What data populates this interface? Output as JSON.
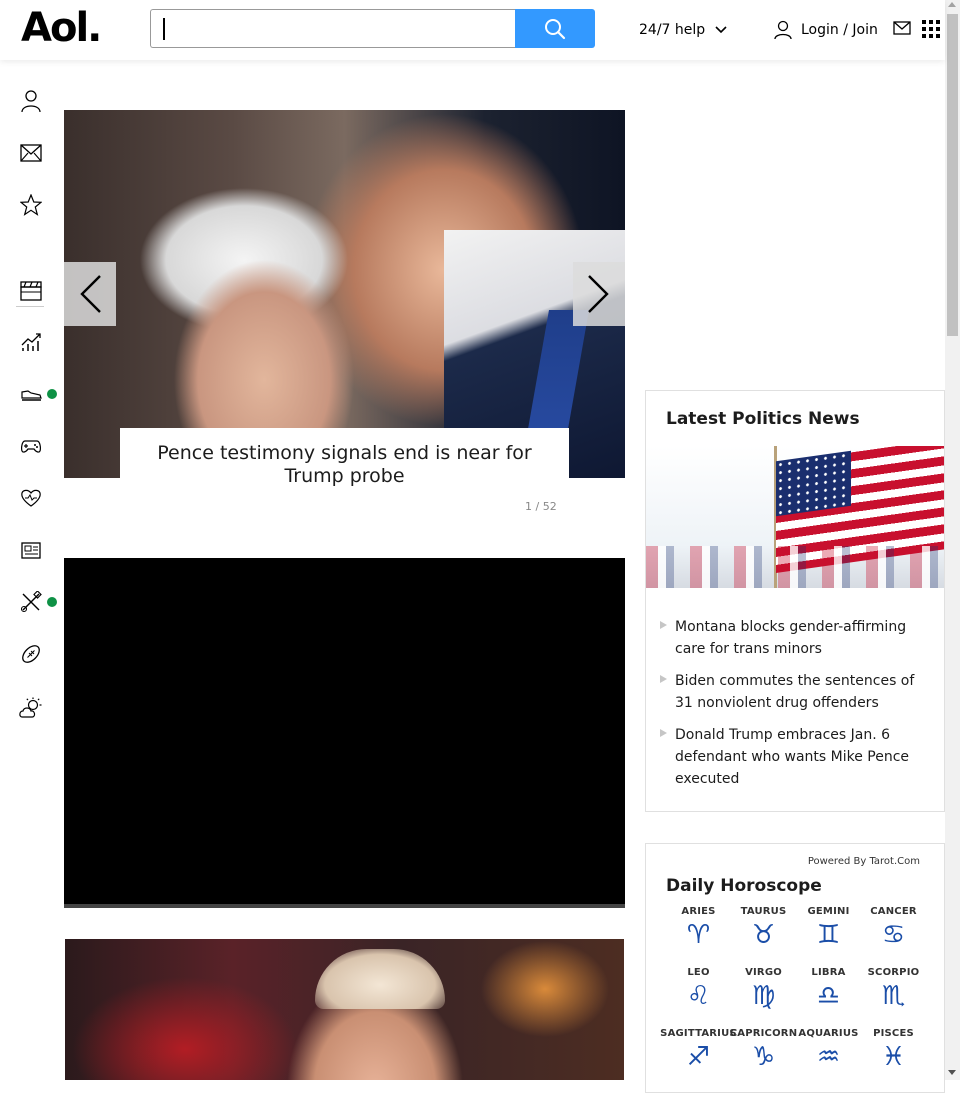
{
  "header": {
    "logo": "Aol.",
    "search_placeholder": "",
    "help_label": "24/7 help",
    "login_label": "Login / Join"
  },
  "sidebar": {
    "items": [
      {
        "name": "profile",
        "icon": "user-icon"
      },
      {
        "name": "mail",
        "icon": "mail-icon"
      },
      {
        "name": "favorites",
        "icon": "star-icon"
      },
      {
        "name": "entertainment",
        "icon": "clapperboard-icon"
      },
      {
        "name": "finance",
        "icon": "chart-icon"
      },
      {
        "name": "lifestyle",
        "icon": "shoe-icon",
        "badge": true
      },
      {
        "name": "games",
        "icon": "gamepad-icon"
      },
      {
        "name": "health",
        "icon": "heart-icon"
      },
      {
        "name": "news",
        "icon": "newspaper-icon"
      },
      {
        "name": "diy",
        "icon": "tools-icon",
        "badge": true
      },
      {
        "name": "sports",
        "icon": "football-icon"
      },
      {
        "name": "weather",
        "icon": "weather-icon"
      }
    ],
    "badge_color": "#0e9145"
  },
  "slideshow": {
    "caption": "Pence testimony signals end is near for Trump probe",
    "counter": "1 / 52"
  },
  "politics": {
    "title": "Latest Politics News",
    "items": [
      "Montana blocks gender-affirming care for trans minors",
      "Biden commutes the sentences of 31 nonviolent drug offenders",
      "Donald Trump embraces Jan. 6 defendant who wants Mike Pence executed"
    ]
  },
  "horoscope": {
    "powered_by": "Powered By Tarot.Com",
    "title": "Daily Horoscope",
    "signs": [
      {
        "name": "ARIES",
        "symbol": "♈"
      },
      {
        "name": "TAURUS",
        "symbol": "♉"
      },
      {
        "name": "GEMINI",
        "symbol": "♊"
      },
      {
        "name": "CANCER",
        "symbol": "♋"
      },
      {
        "name": "LEO",
        "symbol": "♌"
      },
      {
        "name": "VIRGO",
        "symbol": "♍"
      },
      {
        "name": "LIBRA",
        "symbol": "♎"
      },
      {
        "name": "SCORPIO",
        "symbol": "♏"
      },
      {
        "name": "SAGITTARIUS",
        "symbol": "♐"
      },
      {
        "name": "CAPRICORN",
        "symbol": "♑"
      },
      {
        "name": "AQUARIUS",
        "symbol": "♒"
      },
      {
        "name": "PISCES",
        "symbol": "♓"
      }
    ]
  },
  "colors": {
    "search_button": "#3399ff",
    "accent_blue": "#1b4ea8"
  }
}
